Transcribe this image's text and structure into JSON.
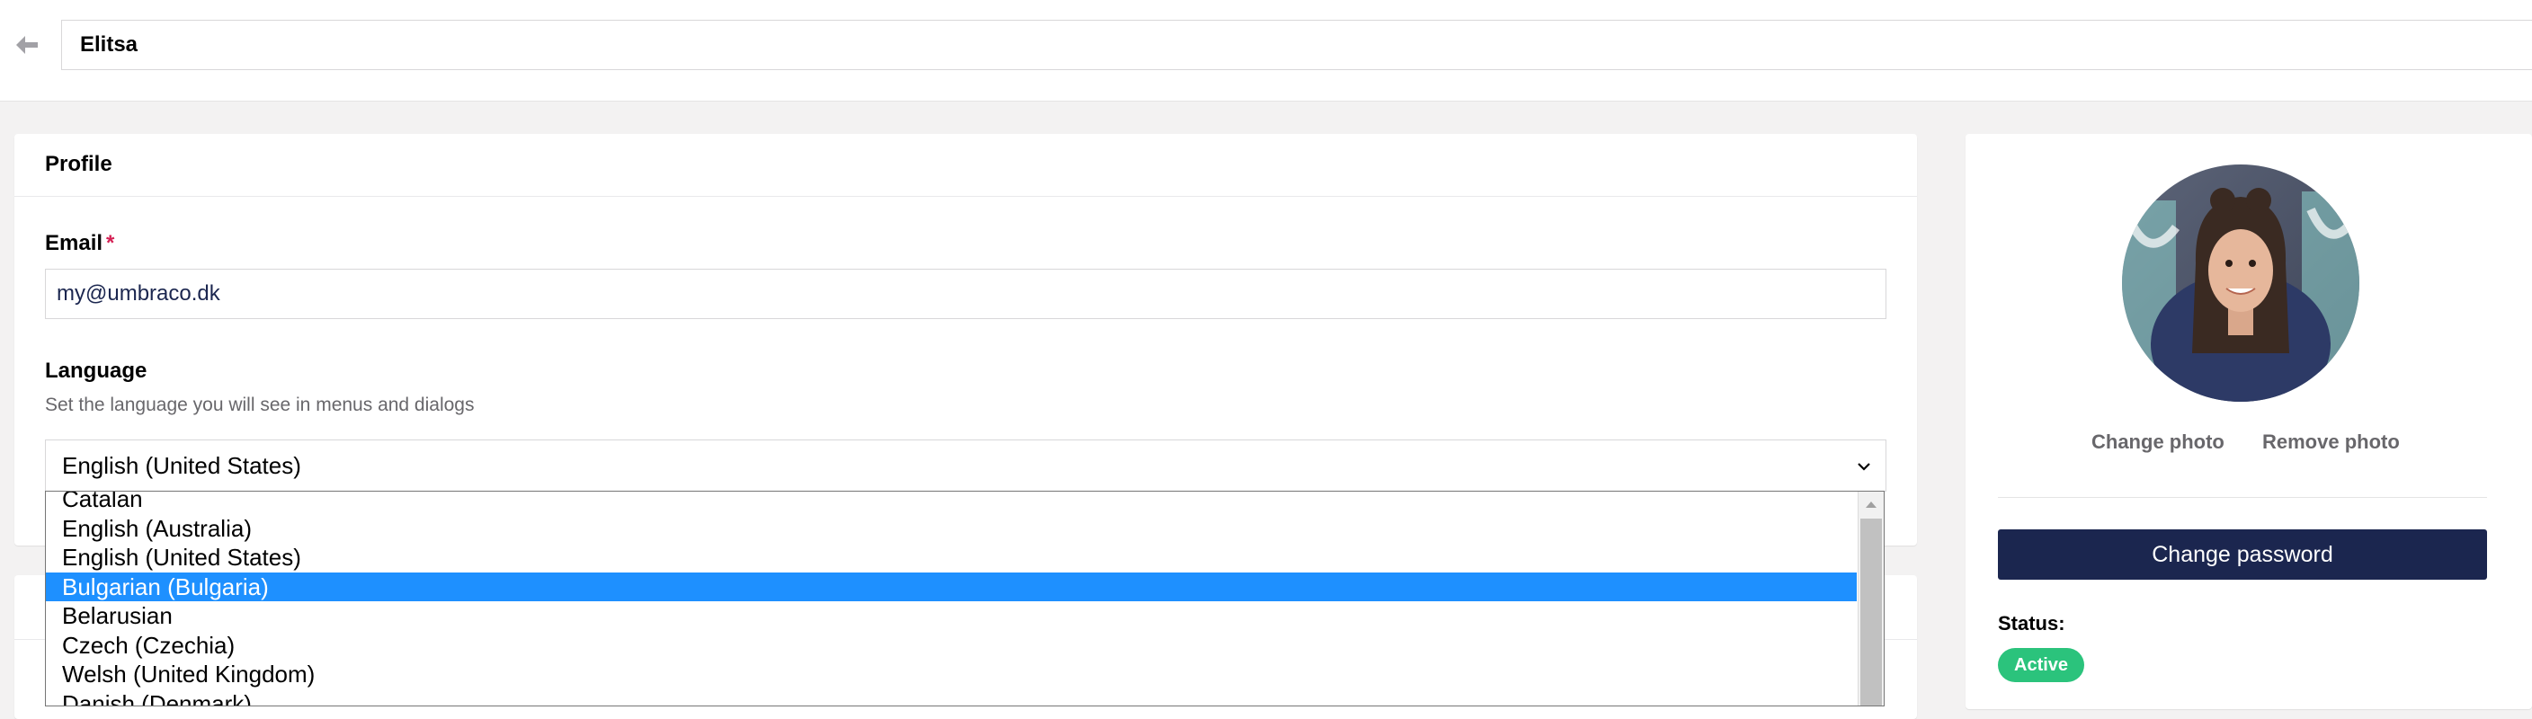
{
  "header": {
    "name_value": "Elitsa"
  },
  "profile": {
    "title": "Profile",
    "email": {
      "label": "Email",
      "required_marker": "*",
      "value": "my@umbraco.dk"
    },
    "language": {
      "label": "Language",
      "description": "Set the language you will see in menus and dialogs",
      "selected": "English (United States)",
      "options": [
        "Catalan",
        "English (Australia)",
        "English (United States)",
        "Bulgarian (Bulgaria)",
        "Belarusian",
        "Czech (Czechia)",
        "Welsh (United Kingdom)",
        "Danish (Denmark)"
      ],
      "highlighted": "Bulgarian (Bulgaria)"
    }
  },
  "sidebar": {
    "change_photo": "Change photo",
    "remove_photo": "Remove photo",
    "change_password": "Change password",
    "status_label": "Status:",
    "status_value": "Active"
  },
  "colors": {
    "primary": "#1b264f",
    "highlight": "#1e90ff",
    "status_active": "#2bc37c",
    "required": "#d42054"
  },
  "icons": {
    "back": "arrow-left-icon",
    "select": "chevron-down-icon",
    "scroll_up": "scroll-up-arrow-icon"
  }
}
